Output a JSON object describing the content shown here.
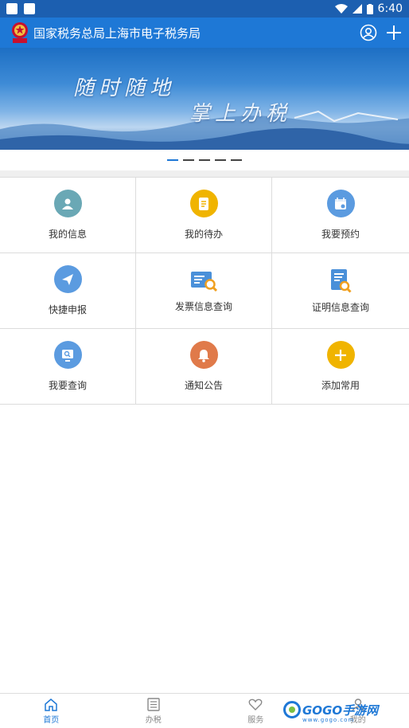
{
  "status_bar": {
    "time": "6:40"
  },
  "app_bar": {
    "title": "国家税务总局上海市电子税务局"
  },
  "banner": {
    "line1": "随时随地",
    "line2": "掌上办税"
  },
  "grid": {
    "items": [
      {
        "label": "我的信息",
        "icon": "person-icon",
        "color": "#6aa8b5"
      },
      {
        "label": "我的待办",
        "icon": "document-icon",
        "color": "#f0b400"
      },
      {
        "label": "我要预约",
        "icon": "calendar-icon",
        "color": "#5b9be0"
      },
      {
        "label": "快捷申报",
        "icon": "paper-plane-icon",
        "color": "#5b9be0"
      },
      {
        "label": "发票信息查询",
        "icon": "invoice-search-icon",
        "color": "#4a90d9"
      },
      {
        "label": "证明信息查询",
        "icon": "certificate-search-icon",
        "color": "#4a90d9"
      },
      {
        "label": "我要查询",
        "icon": "monitor-search-icon",
        "color": "#5b9be0"
      },
      {
        "label": "通知公告",
        "icon": "bell-icon",
        "color": "#e07a4a"
      },
      {
        "label": "添加常用",
        "icon": "plus-icon",
        "color": "#f0b400"
      }
    ]
  },
  "bottom_nav": {
    "items": [
      {
        "label": "首页",
        "icon": "home-icon"
      },
      {
        "label": "办税",
        "icon": "list-icon"
      },
      {
        "label": "服务",
        "icon": "heart-icon"
      },
      {
        "label": "我的",
        "icon": "user-icon"
      }
    ]
  },
  "watermark": {
    "text": "GOGO手游网",
    "sub": "www.gogo.com"
  }
}
